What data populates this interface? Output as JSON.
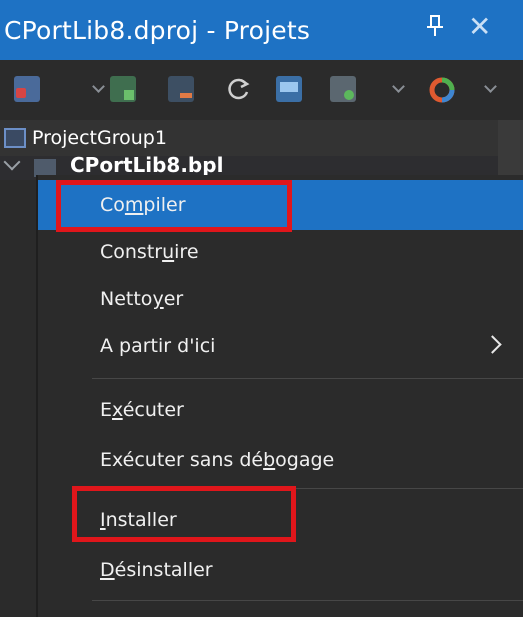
{
  "panel": {
    "title": "CPortLib8.dproj - Projets",
    "pin_glyph": "P",
    "close_glyph": "✕"
  },
  "toolbar": {
    "buttons": [
      {
        "icon": "new-target-icon",
        "color": "#d64545"
      },
      {
        "icon": "add-file-icon",
        "color": "#5aa05a"
      },
      {
        "icon": "add-new-icon",
        "color": "#3c7f3c"
      },
      {
        "icon": "remove-file-icon",
        "color": "#c8693a"
      },
      {
        "icon": "refresh-icon",
        "color": "#c8c8c8"
      },
      {
        "icon": "display-icon",
        "color": "#6fa3d8"
      },
      {
        "icon": "build-configuration-icon",
        "color": "#8c8c8c"
      },
      {
        "icon": "platform-icon",
        "color": "#e05a30"
      }
    ]
  },
  "tree": {
    "group_label": "ProjectGroup1",
    "project_label": "CPortLib8.bpl"
  },
  "context_menu": {
    "items": [
      {
        "before": "Co",
        "accel": "m",
        "after": "piler",
        "selected": true
      },
      {
        "before": "Constr",
        "accel": "u",
        "after": "ire",
        "selected": false
      },
      {
        "before": "Netto",
        "accel": "y",
        "after": "er",
        "selected": false
      },
      {
        "before": "A partir d'ici",
        "accel": "",
        "after": "",
        "selected": false,
        "submenu": true
      },
      {
        "before": "E",
        "accel": "x",
        "after": "écuter",
        "selected": false
      },
      {
        "before": "Exécuter sans dé",
        "accel": "b",
        "after": "ogage",
        "selected": false
      },
      {
        "before": "",
        "accel": "I",
        "after": "nstaller",
        "selected": false
      },
      {
        "before": "",
        "accel": "D",
        "after": "ésinstaller",
        "selected": false
      }
    ]
  },
  "colors": {
    "accent": "#1e72c4",
    "highlight_box": "#e0161b",
    "background": "#2b2b2b"
  }
}
